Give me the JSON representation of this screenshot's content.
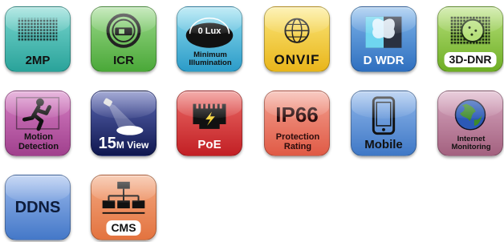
{
  "tiles": [
    {
      "label": "2MP"
    },
    {
      "label": "ICR"
    },
    {
      "badge": "0 Lux",
      "label": "Minimum Illumination"
    },
    {
      "label": "ONVIF"
    },
    {
      "label": "D WDR"
    },
    {
      "label": "3D-DNR"
    },
    {
      "label": "Motion Detection"
    },
    {
      "number": "15",
      "suffix": "M View"
    },
    {
      "label": "PoE"
    },
    {
      "big": "IP66",
      "label": "Protection Rating"
    },
    {
      "label": "Mobile"
    },
    {
      "label": "Internet Monitoring"
    },
    {
      "label": "DDNS"
    },
    {
      "label": "CMS"
    }
  ],
  "colors": {
    "teal": "#34b5a8",
    "green": "#5bb848",
    "cyan": "#3aa9d3",
    "yellow": "#f1c21c",
    "blue": "#4f8fd6",
    "lime": "#7fbb2d",
    "magenta": "#b04f9c",
    "navy": "#1f2b76",
    "red": "#d9272e",
    "coral": "#e36f52",
    "sky": "#5f8fd3",
    "mauve": "#b97a9a",
    "orange": "#e5885c"
  }
}
